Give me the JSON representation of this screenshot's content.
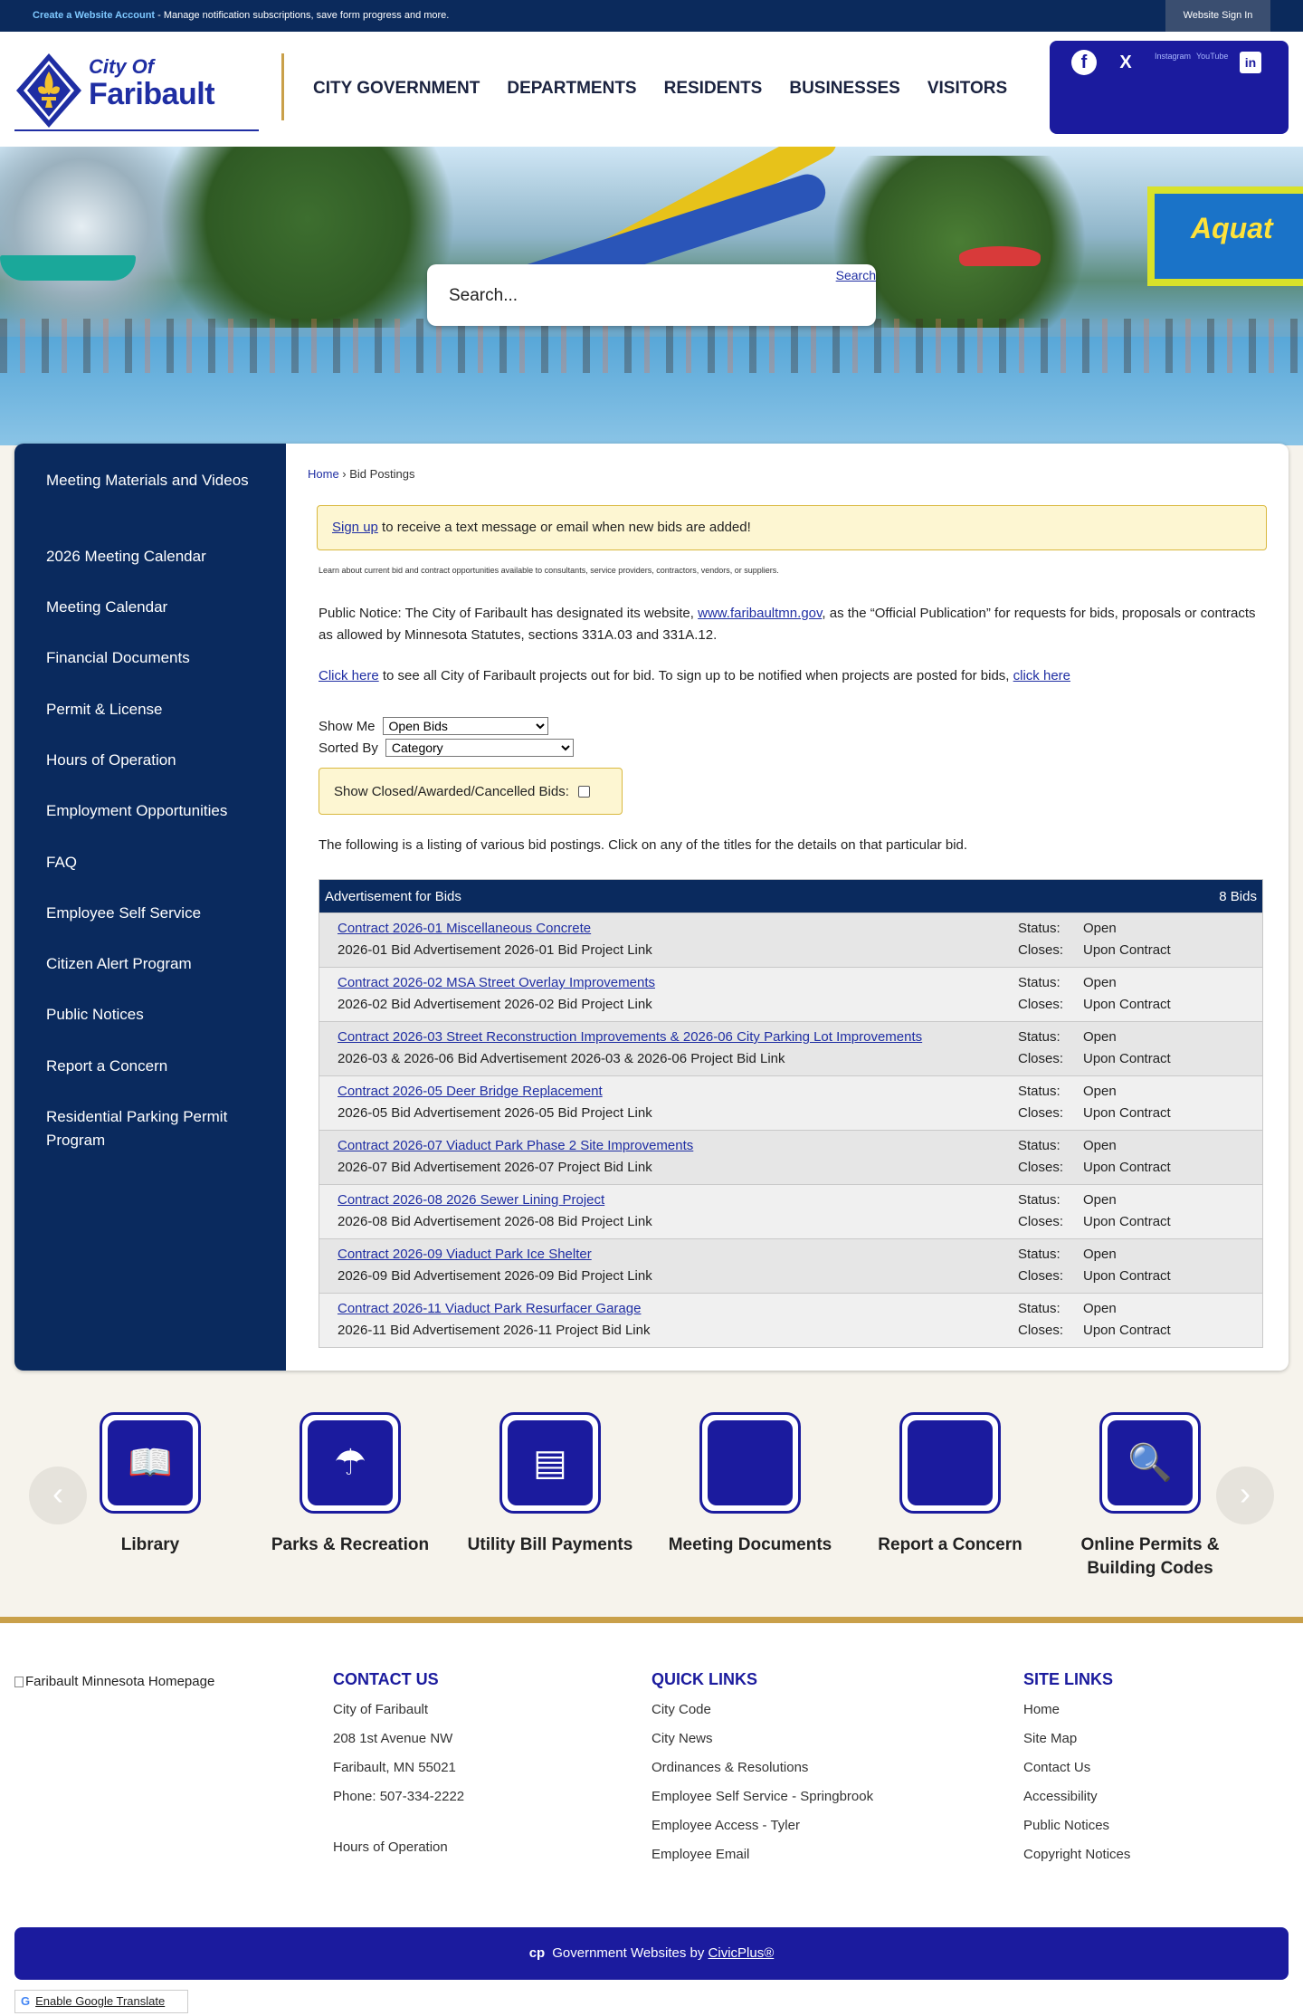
{
  "topbar": {
    "create_link": "Create a Website Account",
    "notice": " - Manage notification subscriptions, save form progress and more.",
    "signin": "Website Sign In"
  },
  "logo": {
    "line1": "City Of",
    "line2": "Faribault"
  },
  "nav": [
    "City Government",
    "Departments",
    "Residents",
    "Businesses",
    "Visitors"
  ],
  "social": {
    "facebook": "f",
    "x": "X",
    "instagram_alt": "Instagram",
    "youtube_alt": "YouTube",
    "linkedin": "in"
  },
  "hero": {
    "aquatic_sign": "Aquat"
  },
  "search": {
    "placeholder": "Search...",
    "button_alt": "Search"
  },
  "sidebar": [
    "Meeting Materials and Videos",
    "2026 Meeting Calendar",
    "Meeting Calendar",
    "Financial Documents",
    "Permit & License",
    "Hours of Operation",
    "Employment Opportunities",
    "FAQ",
    "Employee Self Service",
    "Citizen Alert Program",
    "Public Notices",
    "Report a Concern",
    "Residential Parking Permit Program"
  ],
  "breadcrumb": {
    "home": "Home",
    "sep": " › ",
    "current": "Bid Postings"
  },
  "alert": {
    "link": "Sign up",
    "text": " to receive a text message or email when new bids are added!"
  },
  "intro": "Learn about current bid and contract opportunities available to consultants, service providers, contractors, vendors, or suppliers.",
  "public_notice": {
    "before": "Public Notice: The City of Faribault has designated its website, ",
    "link": "www.faribaultmn.gov",
    "after": ", as the “Official Publication” for requests for bids, proposals or contracts as allowed by Minnesota Statutes, sections 331A.03 and 331A.12."
  },
  "clickline": {
    "link1": "Click here",
    "middle": " to see all City of Faribault projects out for bid. To sign up to be notified when projects are posted for bids, ",
    "link2": "click here"
  },
  "filters": {
    "show_label": "Show Me",
    "show_value": "Open Bids",
    "sort_label": "Sorted By",
    "sort_value": "Category",
    "closed_label": "Show Closed/Awarded/Cancelled Bids:"
  },
  "listing_intro": "The following is a listing of various bid postings. Click on any of the titles for the details on that particular bid.",
  "bids": {
    "category": "Advertisement for Bids",
    "count": "8 Bids",
    "status_label": "Status:",
    "closes_label": "Closes:",
    "rows": [
      {
        "title": "Contract 2026-01 Miscellaneous Concrete",
        "sub": "2026-01 Bid Advertisement 2026-01 Bid Project Link",
        "status": "Open",
        "closes": "Upon Contract"
      },
      {
        "title": "Contract 2026-02 MSA Street Overlay Improvements",
        "sub": "2026-02 Bid Advertisement 2026-02 Bid Project Link",
        "status": "Open",
        "closes": "Upon Contract"
      },
      {
        "title": "Contract 2026-03 Street Reconstruction Improvements & 2026-06 City Parking Lot Improvements",
        "sub": "2026-03 & 2026-06 Bid Advertisement 2026-03 & 2026-06 Project Bid Link",
        "status": "Open",
        "closes": "Upon Contract"
      },
      {
        "title": "Contract 2026-05 Deer Bridge Replacement",
        "sub": "2026-05 Bid Advertisement 2026-05 Bid Project Link",
        "status": "Open",
        "closes": "Upon Contract"
      },
      {
        "title": "Contract 2026-07 Viaduct Park Phase 2 Site Improvements",
        "sub": "2026-07 Bid Advertisement 2026-07 Project Bid Link",
        "status": "Open",
        "closes": "Upon Contract"
      },
      {
        "title": "Contract 2026-08 2026 Sewer Lining Project",
        "sub": "2026-08 Bid Advertisement 2026-08 Bid Project Link",
        "status": "Open",
        "closes": "Upon Contract"
      },
      {
        "title": "Contract 2026-09 Viaduct Park Ice Shelter",
        "sub": "2026-09 Bid Advertisement 2026-09 Bid Project Link",
        "status": "Open",
        "closes": "Upon Contract"
      },
      {
        "title": "Contract 2026-11 Viaduct Park Resurfacer Garage",
        "sub": "2026-11 Bid Advertisement 2026-11 Project Bid Link",
        "status": "Open",
        "closes": "Upon Contract"
      }
    ]
  },
  "quicklinks": [
    {
      "label": "Library",
      "icon": "book-icon"
    },
    {
      "label": "Parks & Recreation",
      "icon": "park-icon"
    },
    {
      "label": "Utility Bill Payments",
      "icon": "bill-icon"
    },
    {
      "label": "Meeting Documents",
      "icon": "documents-icon"
    },
    {
      "label": "Report a Concern",
      "icon": "concern-icon"
    },
    {
      "label": "Online Permits & Building Codes",
      "icon": "permit-search-icon"
    }
  ],
  "footer": {
    "home_alt": "Faribault Minnesota Homepage",
    "contact": {
      "heading": "CONTACT US",
      "lines": [
        "City of Faribault",
        "208 1st Avenue NW",
        "Faribault, MN 55021",
        "Phone: 507-334-2222"
      ],
      "hours": "Hours of Operation"
    },
    "quick": {
      "heading": "QUICK LINKS",
      "links": [
        "City Code",
        "City News",
        "Ordinances & Resolutions",
        "Employee Self Service - Springbrook",
        "Employee Access - Tyler",
        "Employee Email"
      ]
    },
    "site": {
      "heading": "SITE LINKS",
      "links": [
        "Home",
        "Site Map",
        "Contact Us",
        "Accessibility",
        "Public Notices",
        "Copyright Notices"
      ]
    },
    "gov_text": "Government Websites by ",
    "gov_link": "CivicPlus®",
    "translate": "Enable Google Translate"
  }
}
